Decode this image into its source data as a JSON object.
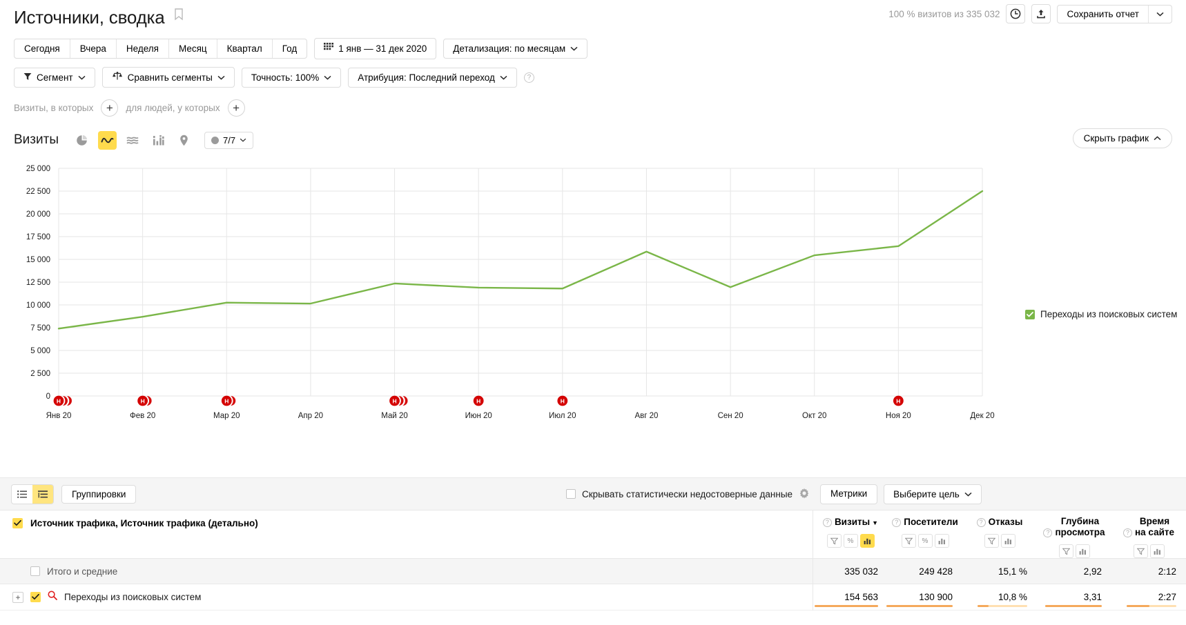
{
  "header": {
    "title": "Источники, сводка",
    "bookmark_icon": "bookmark-icon",
    "visits_note": "100 % визитов из 335 032",
    "history_icon": "clock-icon",
    "export_icon": "share-export-icon",
    "save_report_label": "Сохранить отчет",
    "save_caret_icon": "chevron-down-icon"
  },
  "period_tabs": [
    {
      "label": "Сегодня"
    },
    {
      "label": "Вчера"
    },
    {
      "label": "Неделя"
    },
    {
      "label": "Месяц"
    },
    {
      "label": "Квартал"
    },
    {
      "label": "Год"
    }
  ],
  "date_range": {
    "label": "1 янв — 31 дек 2020",
    "icon": "calendar-icon"
  },
  "detail_select": {
    "label": "Детализация: по месяцам",
    "icon": "chevron-down-icon"
  },
  "filters": {
    "segment": {
      "label": "Сегмент",
      "icon": "funnel-icon",
      "caret": "chevron-down-icon"
    },
    "compare": {
      "label": "Сравнить сегменты",
      "icon": "compare-scales-icon",
      "caret": "chevron-down-icon"
    },
    "accuracy": {
      "label": "Точность: 100%",
      "caret": "chevron-down-icon"
    },
    "attribution": {
      "label": "Атрибуция: Последний переход",
      "caret": "chevron-down-icon"
    },
    "help_icon": "question-mark-icon"
  },
  "filter_builder": {
    "visits_label": "Визиты, в которых",
    "visits_add_icon": "plus-circle-icon",
    "people_label": "для людей, у которых",
    "people_add_icon": "plus-circle-icon"
  },
  "chart_toolbar": {
    "title": "Визиты",
    "view_icons": [
      {
        "name": "pie-chart-icon",
        "active": false
      },
      {
        "name": "line-chart-icon",
        "active": true
      },
      {
        "name": "area-chart-icon",
        "active": false
      },
      {
        "name": "bar-chart-icon",
        "active": false
      },
      {
        "name": "map-pin-icon",
        "active": false
      }
    ],
    "count_pill": {
      "label": "7/7",
      "dot_icon": "gray-dot-icon",
      "caret": "chevron-down-icon"
    },
    "hide_chart_label": "Скрыть график",
    "hide_chart_icon": "chevron-up-icon"
  },
  "chart_data": {
    "type": "line",
    "title": "Визиты",
    "xlabel": "",
    "ylabel": "",
    "ylim": [
      0,
      25000
    ],
    "ytick_step": 2500,
    "ytick_labels": [
      "0",
      "2 500",
      "5 000",
      "7 500",
      "10 000",
      "12 500",
      "15 000",
      "17 500",
      "20 000",
      "22 500",
      "25 000"
    ],
    "grid": true,
    "legend_position": "right",
    "categories": [
      "Янв 20",
      "Фев 20",
      "Мар 20",
      "Апр 20",
      "Май 20",
      "Июн 20",
      "Июл 20",
      "Авг 20",
      "Сен 20",
      "Окт 20",
      "Ноя 20",
      "Дек 20"
    ],
    "series": [
      {
        "name": "Переходы из поисковых систем",
        "color": "#7ab648",
        "values": [
          7400,
          8700,
          10250,
          10150,
          12350,
          11900,
          11800,
          15850,
          11950,
          15450,
          16450,
          22500
        ]
      }
    ],
    "annotations": {
      "marker_label": "Н",
      "marker_color": "#d40000",
      "counts": {
        "Янв 20": 3,
        "Фев 20": 2,
        "Мар 20": 2,
        "Апр 20": 0,
        "Май 20": 3,
        "Июн 20": 1,
        "Июл 20": 1,
        "Авг 20": 0,
        "Сен 20": 0,
        "Окт 20": 0,
        "Ноя 20": 1,
        "Дек 20": 0
      }
    }
  },
  "chart_legend": [
    {
      "label": "Переходы из поисковых систем",
      "color": "#7ab648",
      "checked": true
    }
  ],
  "table_toolbar": {
    "view_list_icon": "list-view-icon",
    "view_tree_icon": "tree-view-icon",
    "groupings_label": "Группировки",
    "hide_unreliable_label": "Скрывать статистически недостоверные данные",
    "settings_icon": "gear-icon",
    "metrics_label": "Метрики",
    "goal_label": "Выберите цель",
    "goal_caret": "chevron-down-icon"
  },
  "table": {
    "dimension_header": "Источник трафика, Источник трафика (детально)",
    "metrics": [
      {
        "label": "Визиты",
        "sorted": true,
        "sort_icon": "sort-desc-icon",
        "buttons": [
          "funnel-icon",
          "percent-icon",
          "bars-icon"
        ],
        "active_button": 2
      },
      {
        "label": "Посетители",
        "sorted": false,
        "buttons": [
          "funnel-icon",
          "percent-icon",
          "bars-icon"
        ],
        "active_button": -1
      },
      {
        "label": "Отказы",
        "sorted": false,
        "buttons": [
          "funnel-icon",
          "bars-icon"
        ],
        "active_button": -1
      },
      {
        "label": "Глубина\nпросмотра",
        "sorted": false,
        "buttons": [
          "funnel-icon",
          "bars-icon"
        ],
        "active_button": -1
      },
      {
        "label": "Время\nна сайте",
        "sorted": false,
        "buttons": [
          "funnel-icon",
          "bars-icon"
        ],
        "active_button": -1
      }
    ],
    "rows": [
      {
        "type": "totals",
        "label": "Итого и средние",
        "checked": false,
        "values": [
          "335 032",
          "249 428",
          "15,1 %",
          "2,92",
          "2:12"
        ],
        "bars": []
      },
      {
        "type": "data",
        "label": "Переходы из поисковых систем",
        "icon": "search-magnifier-icon",
        "checked": true,
        "expandable": true,
        "expand_icon": "plus-box-icon",
        "values": [
          "154 563",
          "130 900",
          "10,8 %",
          "3,31",
          "2:27"
        ],
        "bars": [
          100,
          100,
          22,
          88,
          45
        ]
      }
    ]
  }
}
